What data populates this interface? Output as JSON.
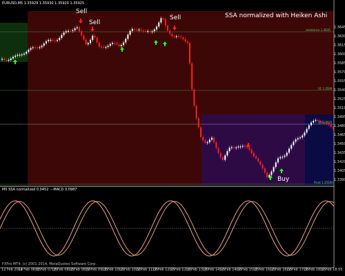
{
  "chart": {
    "symbol_header": "EURUSD,M5  1.35929 1.35930 1.35920 1.35925",
    "title": "SSA normalized with Heiken Ashi",
    "indicator_header": "M5 SSA normalized 0.0452   ---MACD 0.0987",
    "copyright": "FXPro MT4, (c) 2001-2014, MetaQuotes Software Corp.",
    "signals": [
      "Sell",
      "Sell",
      "Sell",
      "Buy"
    ],
    "levels": [
      "resistance 1.3635",
      "S1 1.3590",
      "S2 1.3570",
      "Pivot 1.35560"
    ],
    "price_axis": [
      "1.3645",
      "1.3630",
      "1.3615",
      "1.3600",
      "1.3585",
      "1.3570",
      "1.3555",
      "1.3540",
      "1.3525",
      "1.3510",
      "1.3495",
      "1.3480",
      "1.3465",
      "1.3450",
      "1.3435",
      "1.3420",
      "1.3405",
      "1.3390"
    ],
    "time_axis": [
      "12 Feb 2014",
      "12 Feb 06:55",
      "12 Feb 07:35",
      "12 Feb 08:15",
      "12 Feb 08:55",
      "12 Feb 09:35",
      "12 Feb 10:15",
      "12 Feb 10:55",
      "12 Feb 11:35",
      "12 Feb 12:15",
      "12 Feb 12:55",
      "12 Feb 13:35",
      "12 Feb 14:15",
      "12 Feb 14:55",
      "12 Feb 15:35",
      "12 Feb 16:15",
      "12 Feb 16:55",
      "12 Feb 17:35",
      "12 Feb 18:15",
      "12 Feb 18:55"
    ],
    "colors": {
      "background": "#000000",
      "zone_green": "#0d2f0d",
      "zone_olive": "#333314",
      "zone_red": "#3d0707",
      "zone_purple": "#2e0a45",
      "zone_blue": "#0a0a45",
      "bull_candle": "#ffffff",
      "bear_candle": "#ff2020",
      "buy_arrow": "#20ff20",
      "sell_arrow": "#ff2020",
      "ssa_line": "#ff9a9a",
      "signal_line": "#d8a86a"
    }
  }
}
